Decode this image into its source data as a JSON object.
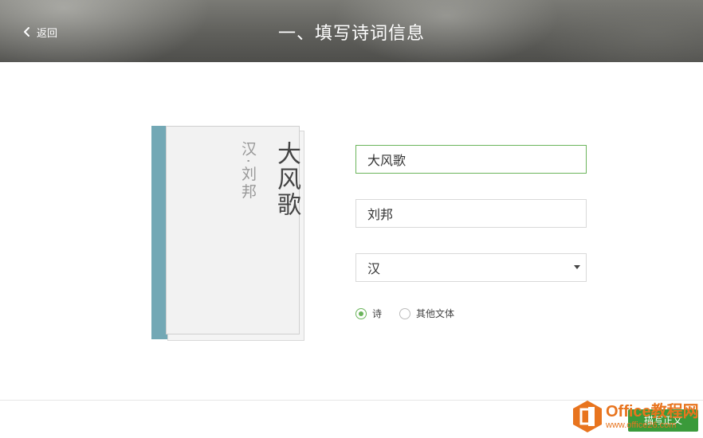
{
  "header": {
    "back_label": "返回",
    "title": "一、填写诗词信息"
  },
  "book": {
    "title": "大风歌",
    "author_line": "汉·刘邦"
  },
  "form": {
    "title_value": "大风歌",
    "author_value": "刘邦",
    "dynasty_value": "汉",
    "radio_options": [
      {
        "label": "诗",
        "checked": true
      },
      {
        "label": "其他文体",
        "checked": false
      }
    ]
  },
  "footer": {
    "next_label": "描写正文"
  },
  "watermark": {
    "main": "Office教程网",
    "sub": "www.office26.com"
  },
  "colors": {
    "accent": "#6bb45b",
    "spine": "#73a8b5",
    "watermark": "#e8741e"
  },
  "icons": [
    "chevron-left-icon",
    "dropdown-caret-icon",
    "office-logo-icon"
  ]
}
